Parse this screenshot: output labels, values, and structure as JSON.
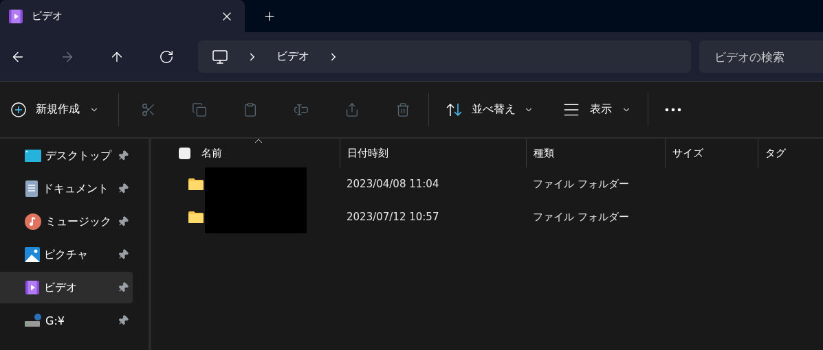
{
  "tabs": [
    {
      "label": "ビデオ",
      "selected": true,
      "kind": "video"
    }
  ],
  "nav_buttons": [
    {
      "kind": "back",
      "disabled": false
    },
    {
      "kind": "forward",
      "disabled": true
    },
    {
      "kind": "up",
      "disabled": false
    },
    {
      "kind": "refresh",
      "disabled": false
    }
  ],
  "breadcrumb": [
    "ビデオ"
  ],
  "search": {
    "placeholder": "ビデオの検索"
  },
  "toolbar": {
    "new_label": "新規作成",
    "actions": [
      {
        "kind": "cut",
        "disabled": true
      },
      {
        "kind": "copy",
        "disabled": true
      },
      {
        "kind": "paste",
        "disabled": true
      },
      {
        "kind": "rename",
        "disabled": true
      },
      {
        "kind": "share",
        "disabled": true
      },
      {
        "kind": "delete",
        "disabled": true
      }
    ],
    "sort_label": "並べ替え",
    "view_label": "表示"
  },
  "sidebar": {
    "items": [
      {
        "kind": "desktop",
        "label": "デスクトップ",
        "selected": false,
        "pinned": true
      },
      {
        "kind": "documents",
        "label": "ドキュメント",
        "selected": false,
        "pinned": true
      },
      {
        "kind": "music",
        "label": "ミュージック",
        "selected": false,
        "pinned": true
      },
      {
        "kind": "pictures",
        "label": "ピクチャ",
        "selected": false,
        "pinned": true
      },
      {
        "kind": "video",
        "label": "ビデオ",
        "selected": true,
        "pinned": true
      },
      {
        "kind": "drive",
        "label": "G:¥",
        "selected": false,
        "pinned": true
      }
    ]
  },
  "table": {
    "select_all": {
      "checked": false
    },
    "columns": [
      "名前",
      "日付時刻",
      "種類",
      "サイズ",
      "タグ"
    ],
    "rows": [
      {
        "date": "2023/04/08 11:04",
        "type": "ファイル フォルダー",
        "redacted": true
      },
      {
        "date": "2023/07/12 10:57",
        "type": "ファイル フォルダー",
        "redacted": true
      }
    ]
  }
}
